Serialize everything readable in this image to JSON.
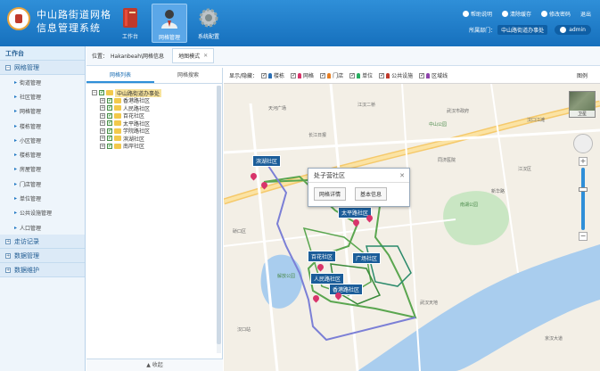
{
  "header": {
    "title_line1": "中山路街道网格",
    "title_line2": "信息管理系统",
    "nav": [
      {
        "label": "工作台",
        "icon": "book-icon"
      },
      {
        "label": "网格管理",
        "icon": "user-icon"
      },
      {
        "label": "系统配置",
        "icon": "gear-icon"
      }
    ],
    "utils": [
      "帮助说明",
      "清除缓存",
      "修改密码",
      "退出"
    ],
    "dept_prefix": "所属部门：",
    "dept": "中山路街道办事处",
    "user": "admin"
  },
  "sidebar": {
    "top": "工作台",
    "groups": [
      {
        "label": "网格管理",
        "expanded": true,
        "items": [
          "街道管理",
          "社区管理",
          "网格管理",
          "楼栋管理",
          "小区管理",
          "楼栋管理",
          "房屋管理",
          "门店管理",
          "单位管理",
          "公共设施管理",
          "人口管理"
        ]
      },
      {
        "label": "走访记录",
        "expanded": false,
        "items": []
      },
      {
        "label": "数据管理",
        "expanded": false,
        "items": []
      },
      {
        "label": "数据维护",
        "expanded": false,
        "items": []
      }
    ]
  },
  "breadcrumb": {
    "prefix": "位置：",
    "path": "Hakanbeah\\网格信息",
    "tab": "地图模式"
  },
  "left_panel": {
    "tabs": [
      "网格列表",
      "网格搜索"
    ],
    "tree": [
      {
        "label": "中山路街道办事处",
        "level": 0
      },
      {
        "label": "香港路社区",
        "level": 1
      },
      {
        "label": "人民路社区",
        "level": 1
      },
      {
        "label": "百花社区",
        "level": 1
      },
      {
        "label": "太平路社区",
        "level": 1
      },
      {
        "label": "学院路社区",
        "level": 1
      },
      {
        "label": "滨湖社区",
        "level": 1
      },
      {
        "label": "南岸社区",
        "level": 1
      }
    ],
    "collapse": "收起"
  },
  "map": {
    "toolbar_label": "显示/隐藏：",
    "layers": [
      {
        "label": "楼栋",
        "color": "#2b6fb5"
      },
      {
        "label": "网格",
        "color": "#d8346b"
      },
      {
        "label": "门店",
        "color": "#e67e22"
      },
      {
        "label": "单位",
        "color": "#27ae60"
      },
      {
        "label": "公共设施",
        "color": "#c0392b"
      },
      {
        "label": "区域线",
        "color": "#8e44ad"
      }
    ],
    "toolbar_right": "图例",
    "satellite": "卫星",
    "popup": {
      "title": "处子营社区",
      "btn1": "网格详情",
      "btn2": "基本信息"
    },
    "tags": [
      "滨湖社区",
      "太平路社区",
      "百花社区",
      "广场社区",
      "人民路社区",
      "香港路社区"
    ],
    "labels": [
      "天河广场",
      "江汉二桥",
      "武汉市政府",
      "中山公园",
      "汉口江滩",
      "长江日报",
      "解放公园",
      "同济医院",
      "江汉区",
      "硚口区",
      "武汉天地",
      "汉口站",
      "新华路",
      "京汉大道",
      "南湖公园"
    ]
  }
}
